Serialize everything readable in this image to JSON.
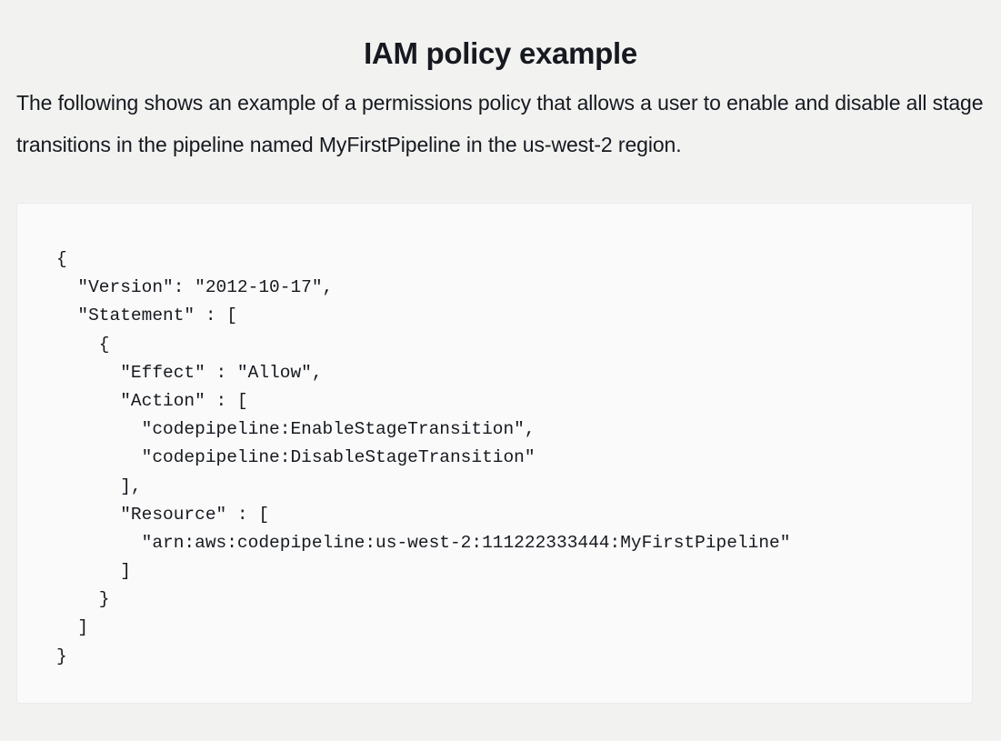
{
  "heading": "IAM policy example",
  "intro": "The following shows an example of a permissions policy that allows a user to enable and disable all stage transitions in the pipeline named MyFirstPipeline in the us-west-2 region.",
  "code": {
    "lines": [
      "{",
      "  \"Version\": \"2012-10-17\",",
      "  \"Statement\" : [",
      "    {",
      "      \"Effect\" : \"Allow\",",
      "      \"Action\" : [",
      "        \"codepipeline:EnableStageTransition\",",
      "        \"codepipeline:DisableStageTransition\"",
      "      ],",
      "      \"Resource\" : [",
      "        \"arn:aws:codepipeline:us-west-2:111222333444:MyFirstPipeline\"",
      "      ]",
      "    }",
      "  ]",
      "}"
    ]
  }
}
